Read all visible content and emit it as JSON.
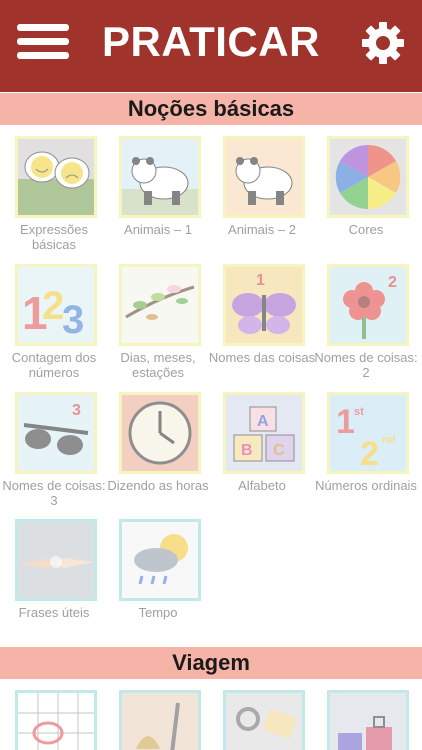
{
  "header": {
    "title": "PRATICAR"
  },
  "sections": [
    {
      "title": "Noções básicas"
    },
    {
      "title": "Viagem"
    }
  ],
  "tiles": [
    {
      "label": "Expressões básicas",
      "icon": "smiley-faces-icon"
    },
    {
      "label": "Animais – 1",
      "icon": "panda-icon"
    },
    {
      "label": "Animais – 2",
      "icon": "panda-icon"
    },
    {
      "label": "Cores",
      "icon": "color-wheel-icon"
    },
    {
      "label": "Contagem dos números",
      "icon": "numbers-123-icon"
    },
    {
      "label": "Dias, meses, estações",
      "icon": "branch-leaves-icon"
    },
    {
      "label": "Nomes das coisas",
      "icon": "butterfly-icon"
    },
    {
      "label": "Nomes de coisas: 2",
      "icon": "flower-icon"
    },
    {
      "label": "Nomes de coisas: 3",
      "icon": "sunglasses-icon"
    },
    {
      "label": "Dizendo as horas",
      "icon": "clock-icon"
    },
    {
      "label": "Alfabeto",
      "icon": "abc-blocks-icon"
    },
    {
      "label": "Números ordinais",
      "icon": "ordinal-1st-2nd-icon"
    },
    {
      "label": "Frases úteis",
      "icon": "handshake-icon"
    },
    {
      "label": "Tempo",
      "icon": "weather-cloud-icon"
    },
    {
      "label": "",
      "icon": "calendar-icon"
    },
    {
      "label": "",
      "icon": "reception-bell-icon"
    },
    {
      "label": "",
      "icon": "key-tag-icon"
    },
    {
      "label": "",
      "icon": "luggage-icon"
    }
  ],
  "colors": {
    "header": "#a0332b",
    "section": "#f6b3a7",
    "tile_border": "#f0ec8c",
    "tile_border_teal": "#8fd8d8",
    "label": "#a0a0a0"
  }
}
